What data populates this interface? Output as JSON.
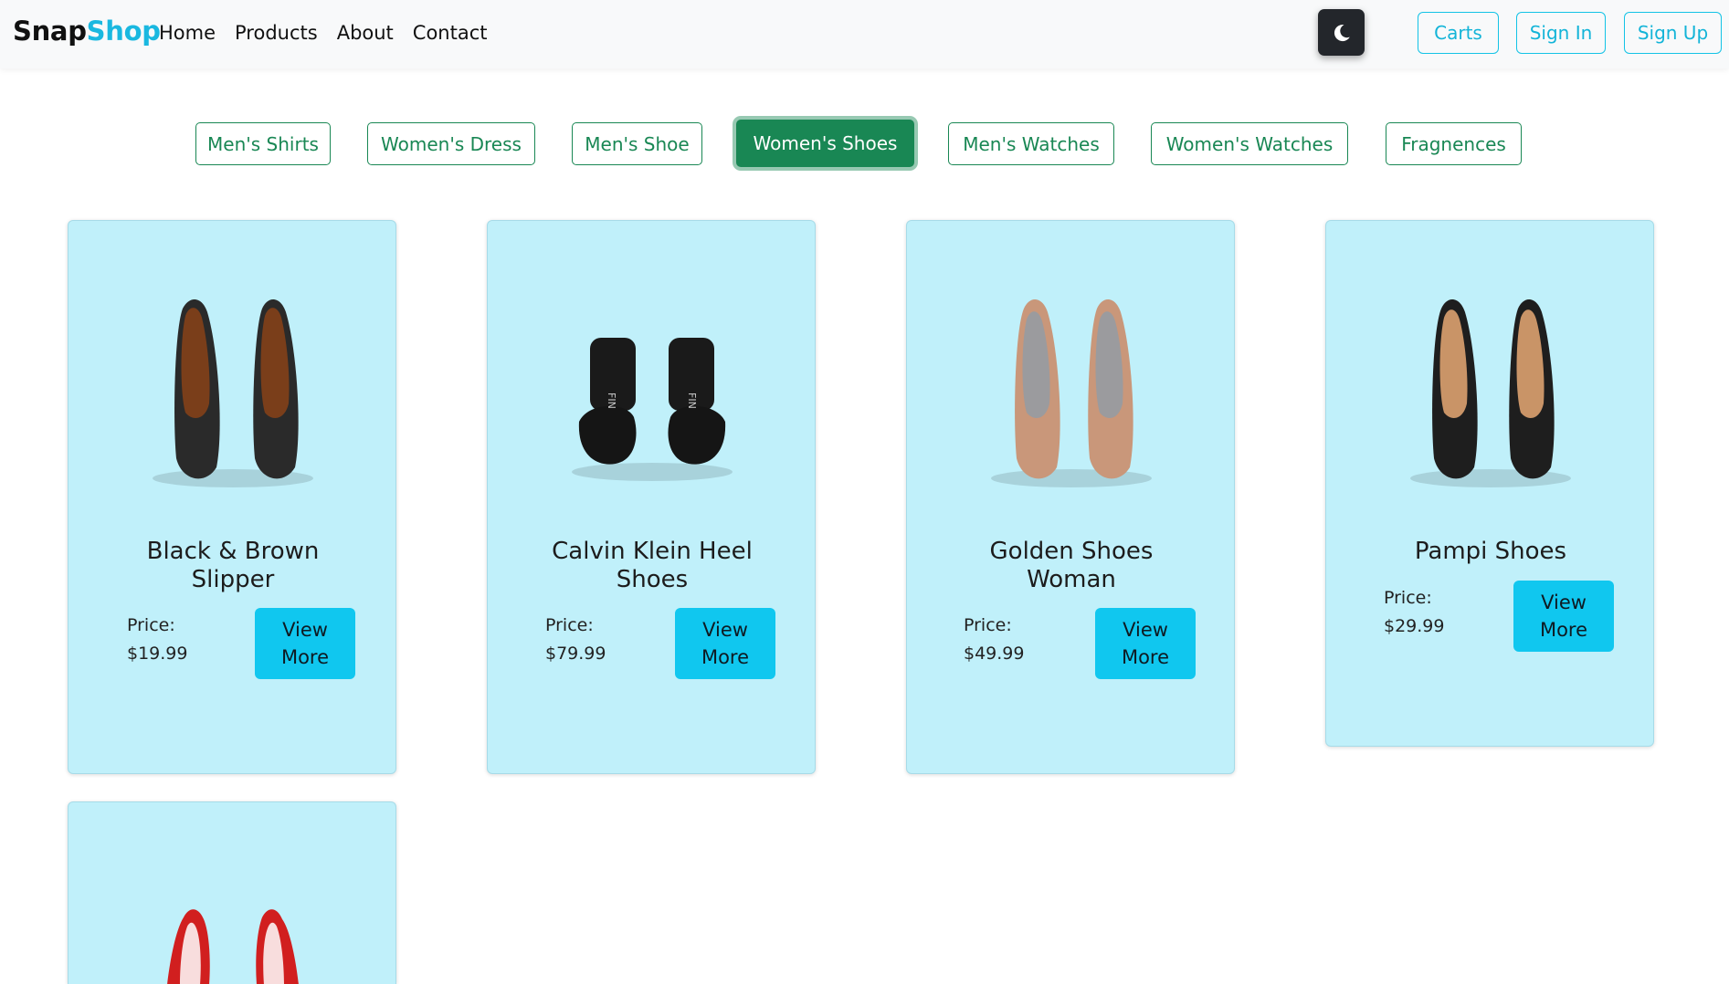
{
  "brand": {
    "part1": "Snap",
    "part2": "Shop"
  },
  "nav": {
    "links": [
      "Home",
      "Products",
      "About",
      "Contact"
    ]
  },
  "header_buttons": {
    "theme_icon": "moon-icon",
    "carts": "Carts",
    "sign_in": "Sign In",
    "sign_up": "Sign Up"
  },
  "categories": {
    "items": [
      "Men's Shirts",
      "Women's Dress",
      "Men's Shoe",
      "Women's Shoes",
      "Men's Watches",
      "Women's Watches",
      "Fragnences"
    ],
    "active": "Women's Shoes"
  },
  "products": [
    {
      "title_line1": "Black & Brown",
      "title_line2": "Slipper",
      "price_label": "Price:",
      "price": "$19.99",
      "button_line1": "View",
      "button_line2": "More"
    },
    {
      "title_line1": "Calvin Klein Heel",
      "title_line2": "Shoes",
      "price_label": "Price:",
      "price": "$79.99",
      "button_line1": "View",
      "button_line2": "More"
    },
    {
      "title_line1": "Golden Shoes",
      "title_line2": "Woman",
      "price_label": "Price:",
      "price": "$49.99",
      "button_line1": "View",
      "button_line2": "More"
    },
    {
      "title_line1": "Pampi Shoes",
      "title_line2": "",
      "price_label": "Price:",
      "price": "$29.99",
      "button_line1": "View",
      "button_line2": "More"
    }
  ],
  "colors": {
    "accent": "#13c3e6",
    "category_green": "#198754",
    "card_bg": "#c0f0fa",
    "view_button": "#10c7ef",
    "theme_button": "#23262b"
  }
}
